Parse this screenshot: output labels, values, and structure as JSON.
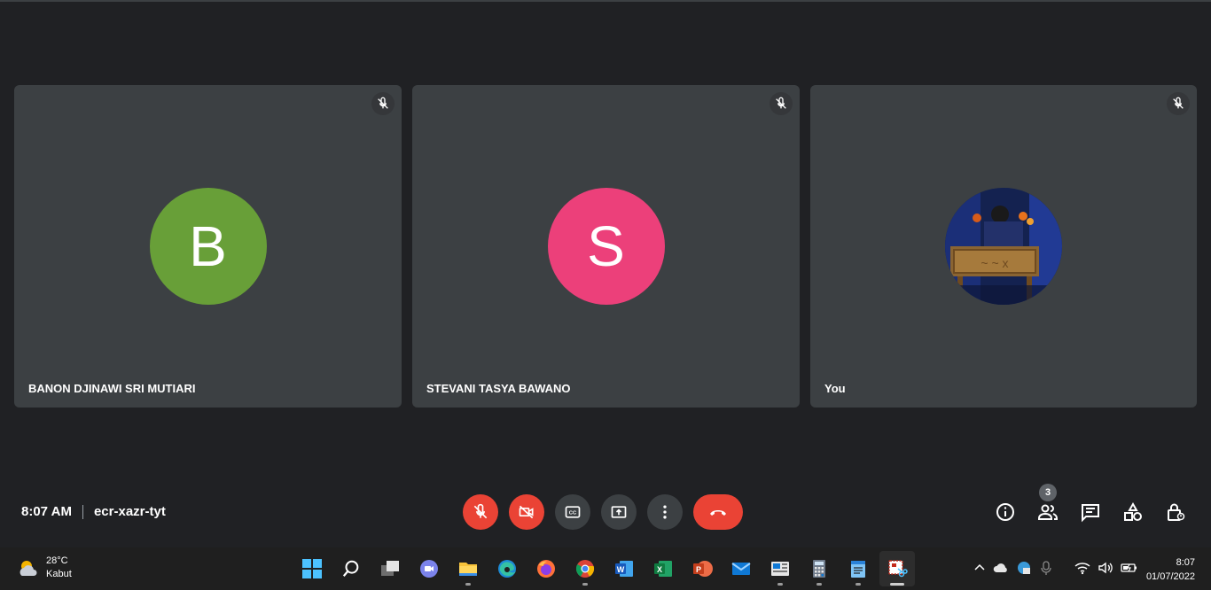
{
  "participants": [
    {
      "name": "BANON DJINAWI SRI MUTIARI",
      "initial": "B",
      "avatar_color": "#689f38",
      "muted": true
    },
    {
      "name": "STEVANI TASYA BAWANO",
      "initial": "S",
      "avatar_color": "#ec407a",
      "muted": true
    },
    {
      "name": "You",
      "initial": "",
      "avatar_type": "photo",
      "muted": true
    }
  ],
  "meeting": {
    "time": "8:07 AM",
    "code": "ecr-xazr-tyt",
    "people_count": "3"
  },
  "controls": [
    "microphone-off",
    "camera-off",
    "captions",
    "present-screen",
    "more-options",
    "leave-call"
  ],
  "right_controls": [
    "meeting-details",
    "people",
    "chat",
    "activities",
    "host-controls"
  ],
  "taskbar": {
    "weather_temp": "28°C",
    "weather_desc": "Kabut",
    "apps": [
      "start",
      "search",
      "task-view",
      "teams-chat",
      "file-explorer",
      "edge",
      "firefox",
      "chrome",
      "word",
      "excel",
      "powerpoint",
      "mail",
      "news",
      "calculator",
      "notepad",
      "snipping-tool"
    ],
    "clock_time": "8:07",
    "clock_date": "01/07/2022"
  },
  "colors": {
    "background": "#202124",
    "tile": "#3c4043",
    "danger": "#ea4335"
  }
}
